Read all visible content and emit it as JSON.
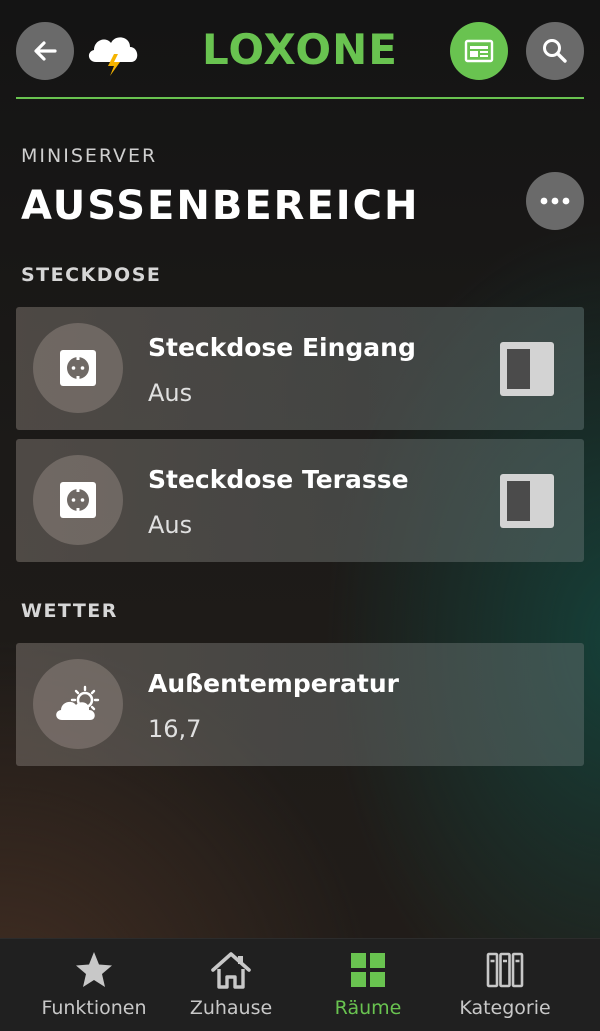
{
  "header": {
    "logo_text": "LOXONE",
    "back_icon": "arrow-left-icon",
    "weather_icon": "thunderstorm-cloud-icon",
    "news_icon": "newspaper-icon",
    "search_icon": "search-icon"
  },
  "room": {
    "subtitle": "MINISERVER",
    "title": "AUSSENBEREICH",
    "more_icon": "more-dots-icon"
  },
  "sections": [
    {
      "label": "STECKDOSE",
      "cards": [
        {
          "title": "Steckdose Eingang",
          "value": "Aus",
          "icon": "power-socket-icon",
          "toggle_on": false
        },
        {
          "title": "Steckdose Terasse",
          "value": "Aus",
          "icon": "power-socket-icon",
          "toggle_on": false
        }
      ]
    },
    {
      "label": "WETTER",
      "cards": [
        {
          "title": "Außentemperatur",
          "value": "16,7",
          "icon": "partly-cloudy-icon"
        }
      ]
    }
  ],
  "bottom_nav": [
    {
      "label": "Funktionen",
      "icon": "star-icon",
      "active": false
    },
    {
      "label": "Zuhause",
      "icon": "house-icon",
      "active": false
    },
    {
      "label": "Räume",
      "icon": "rooms-grid-icon",
      "active": true
    },
    {
      "label": "Kategorie",
      "icon": "binders-icon",
      "active": false
    }
  ],
  "colors": {
    "accent": "#69c350",
    "button_gray": "#6a6a6a",
    "nav_background": "#202020"
  }
}
